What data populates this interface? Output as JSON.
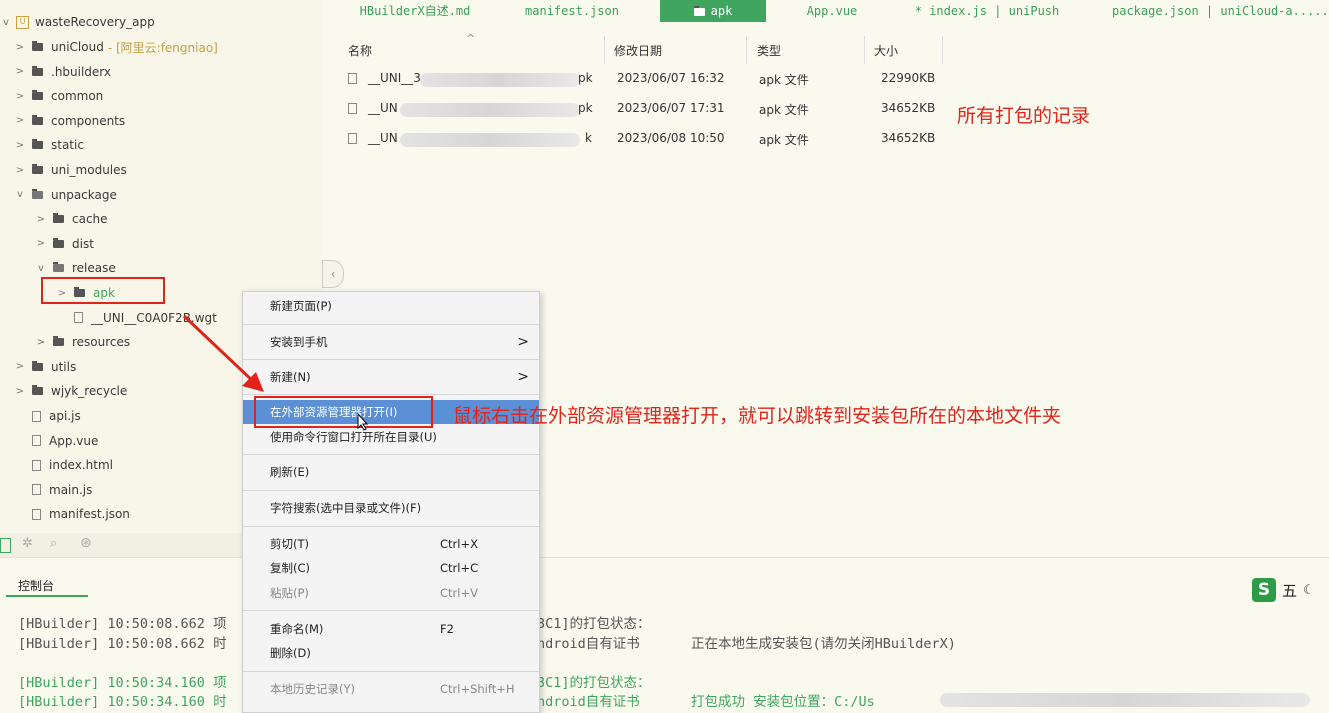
{
  "sidebar": {
    "project": "wasteRecovery_app",
    "items": [
      {
        "label": "uniCloud",
        "tag": "- [阿里云:fengniao]",
        "kind": "folder",
        "chev": ">"
      },
      {
        "label": ".hbuilderx",
        "kind": "folder",
        "chev": ">"
      },
      {
        "label": "common",
        "kind": "folder",
        "chev": ">"
      },
      {
        "label": "components",
        "kind": "folder",
        "chev": ">"
      },
      {
        "label": "static",
        "kind": "folder",
        "chev": ">"
      },
      {
        "label": "uni_modules",
        "kind": "folder",
        "chev": ">"
      },
      {
        "label": "unpackage",
        "kind": "folder-open",
        "chev": "v"
      },
      {
        "label": "cache",
        "kind": "folder",
        "chev": ">"
      },
      {
        "label": "dist",
        "kind": "folder",
        "chev": ">"
      },
      {
        "label": "release",
        "kind": "folder-open",
        "chev": "v"
      },
      {
        "label": "apk",
        "kind": "folder",
        "chev": ">"
      },
      {
        "label": "__UNI__C0A0F2B.wgt",
        "kind": "file",
        "chev": ""
      },
      {
        "label": "resources",
        "kind": "folder",
        "chev": ">"
      },
      {
        "label": "utils",
        "kind": "folder",
        "chev": ">"
      },
      {
        "label": "wjyk_recycle",
        "kind": "folder",
        "chev": ">"
      },
      {
        "label": "api.js",
        "kind": "file",
        "chev": ""
      },
      {
        "label": "App.vue",
        "kind": "file",
        "chev": ""
      },
      {
        "label": "index.html",
        "kind": "file",
        "chev": ""
      },
      {
        "label": "main.js",
        "kind": "file",
        "chev": ""
      },
      {
        "label": "manifest.json",
        "kind": "file",
        "chev": ""
      }
    ]
  },
  "tabs": [
    "HBuilderX自述.md",
    "manifest.json",
    "apk",
    "App.vue",
    "* index.js | uniPush",
    "package.json | uniCloud-a......"
  ],
  "file_list": {
    "headers": [
      "名称",
      "修改日期",
      "类型",
      "大小"
    ],
    "rows": [
      {
        "name_start": "__UNI__3",
        "name_end": "pk",
        "date": "2023/06/07 16:32",
        "type": "apk 文件",
        "size": "22990KB"
      },
      {
        "name_start": "__UN",
        "name_end": "pk",
        "date": "2023/06/07 17:31",
        "type": "apk 文件",
        "size": "34652KB"
      },
      {
        "name_start": "__UN",
        "name_end": "k",
        "date": "2023/06/08 10:50",
        "type": "apk 文件",
        "size": "34652KB"
      }
    ]
  },
  "annotations": {
    "records": "所有打包的记录",
    "tip": "鼠标右击在外部资源管理器打开，就可以跳转到安装包所在的本地文件夹"
  },
  "context_menu": {
    "items": [
      {
        "label": "新建页面(P)",
        "shortcut": "",
        "arrow": ""
      },
      {
        "label": "安装到手机",
        "shortcut": "",
        "arrow": ">"
      },
      {
        "label": "新建(N)",
        "shortcut": "",
        "arrow": ">"
      },
      {
        "label": "在外部资源管理器打开(I)",
        "shortcut": "",
        "arrow": ""
      },
      {
        "label": "使用命令行窗口打开所在目录(U)",
        "shortcut": "",
        "arrow": ""
      },
      {
        "label": "刷新(E)",
        "shortcut": "",
        "arrow": ""
      },
      {
        "label": "字符搜索(选中目录或文件)(F)",
        "shortcut": "",
        "arrow": ""
      },
      {
        "label": "剪切(T)",
        "shortcut": "Ctrl+X",
        "arrow": ""
      },
      {
        "label": "复制(C)",
        "shortcut": "Ctrl+C",
        "arrow": ""
      },
      {
        "label": "粘贴(P)",
        "shortcut": "Ctrl+V",
        "arrow": ""
      },
      {
        "label": "重命名(M)",
        "shortcut": "F2",
        "arrow": ""
      },
      {
        "label": "删除(D)",
        "shortcut": "",
        "arrow": ""
      },
      {
        "label": "本地历史记录(Y)",
        "shortcut": "Ctrl+Shift+H",
        "arrow": ""
      }
    ]
  },
  "console": {
    "tab": "控制台",
    "lines": [
      {
        "left": "[HBuilder] 10:50:08.662 项",
        "right": "3C1]的打包状态：",
        "extra": ""
      },
      {
        "left": "[HBuilder] 10:50:08.662 时",
        "right": "ndroid自有证书",
        "extra": "正在本地生成安装包(请勿关闭HBuilderX)"
      },
      {
        "left": "[HBuilder] 10:50:34.160 项",
        "right": "3C1]的打包状态：",
        "extra": ""
      },
      {
        "left": "[HBuilder] 10:50:34.160 时",
        "right": "ndroid自有证书",
        "extra": "打包成功    安装包位置：C:/Us"
      }
    ]
  },
  "ime": {
    "logo": "S",
    "mode": "五"
  },
  "colors": {
    "accent": "#3fa55f",
    "annotation": "#e0241b",
    "highlight": "#5b8fd6"
  }
}
